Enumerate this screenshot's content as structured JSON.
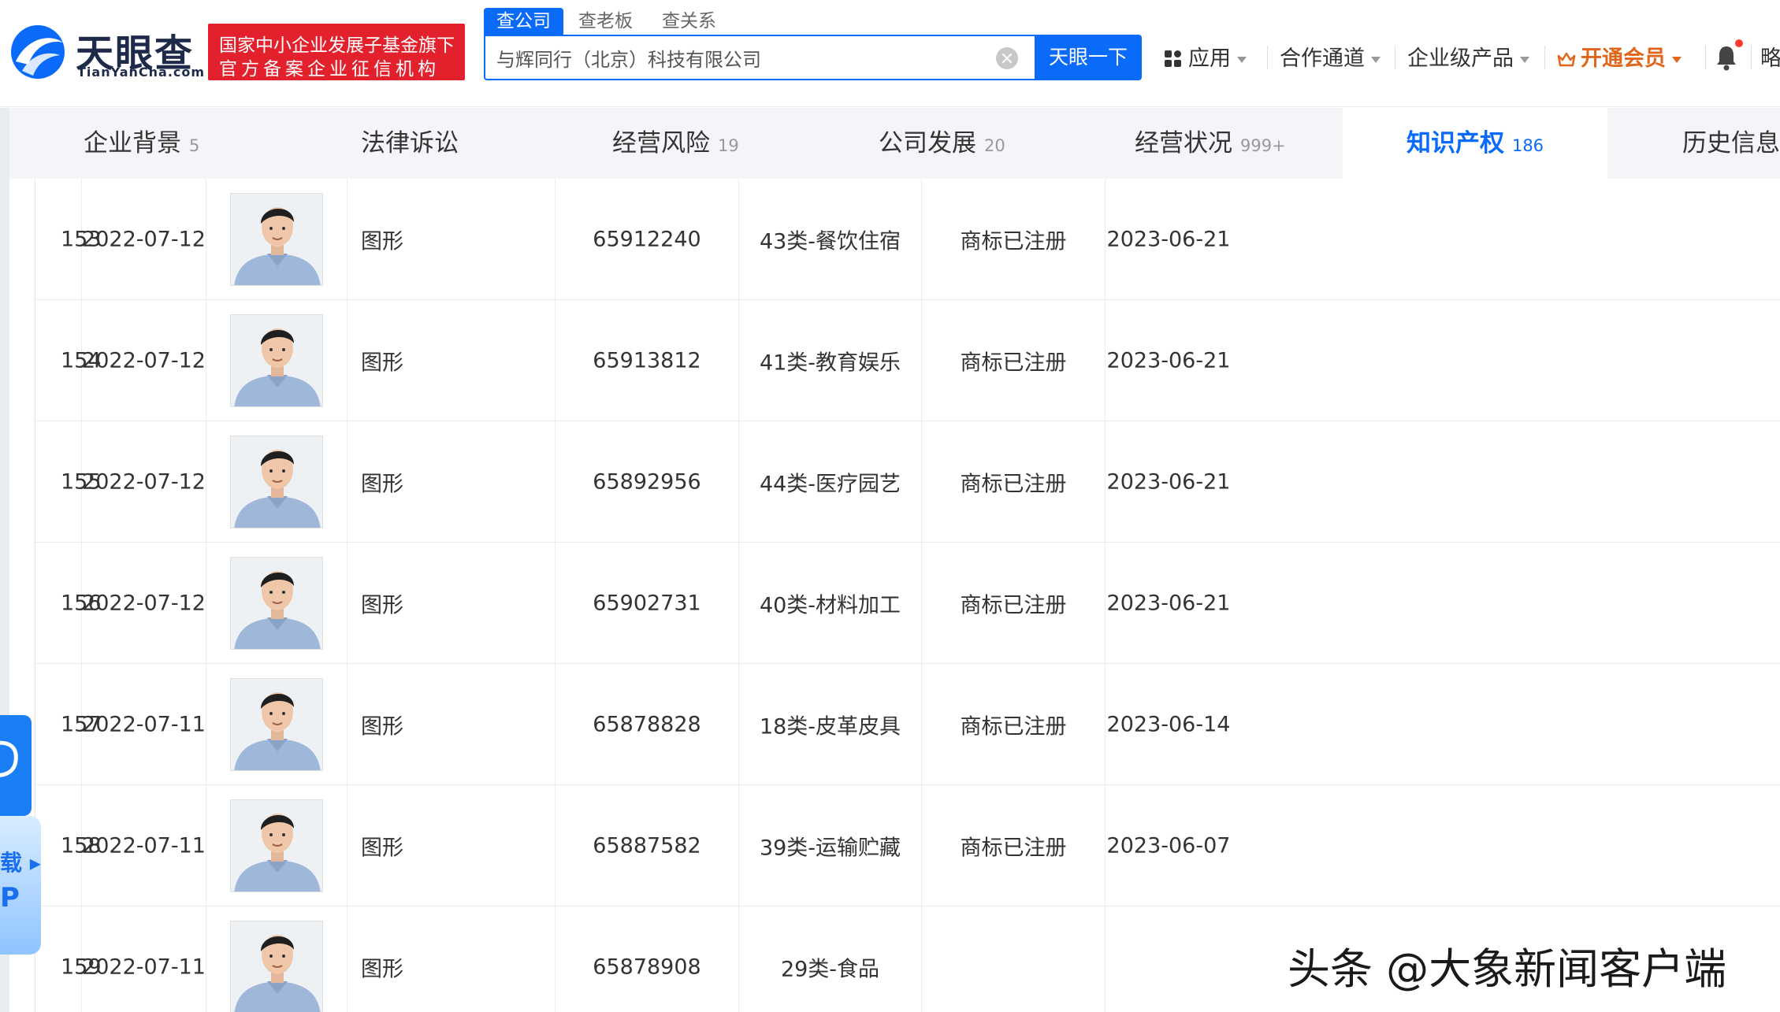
{
  "brand": {
    "logo_cn": "天眼查",
    "logo_en": "TianYanCha.com",
    "gov_line1": "国家中小企业发展子基金旗下",
    "gov_line2": "官方备案企业征信机构",
    "brand_color": "#0a6bfa",
    "badge_color": "#e3212c"
  },
  "search": {
    "tabs": [
      "查公司",
      "查老板",
      "查关系"
    ],
    "value": "与辉同行（北京）科技有限公司",
    "button": "天眼一下"
  },
  "nav": {
    "apps": "应用",
    "partner": "合作通道",
    "enterprise": "企业级产品",
    "vip": "开通会员",
    "cut": "略"
  },
  "categories": [
    {
      "label": "企业背景",
      "count": "5"
    },
    {
      "label": "法律诉讼",
      "count": ""
    },
    {
      "label": "经营风险",
      "count": "19"
    },
    {
      "label": "公司发展",
      "count": "20"
    },
    {
      "label": "经营状况",
      "count": "999+"
    },
    {
      "label": "知识产权",
      "count": "186"
    },
    {
      "label": "历史信息",
      "count": ""
    }
  ],
  "trademarks": [
    {
      "idx": "153",
      "apply_date": "2022-07-12",
      "name": "图形",
      "reg_no": "65912240",
      "class": "43类-餐饮住宿",
      "status": "商标已注册",
      "date": "2023-06-21"
    },
    {
      "idx": "154",
      "apply_date": "2022-07-12",
      "name": "图形",
      "reg_no": "65913812",
      "class": "41类-教育娱乐",
      "status": "商标已注册",
      "date": "2023-06-21"
    },
    {
      "idx": "155",
      "apply_date": "2022-07-12",
      "name": "图形",
      "reg_no": "65892956",
      "class": "44类-医疗园艺",
      "status": "商标已注册",
      "date": "2023-06-21"
    },
    {
      "idx": "156",
      "apply_date": "2022-07-12",
      "name": "图形",
      "reg_no": "65902731",
      "class": "40类-材料加工",
      "status": "商标已注册",
      "date": "2023-06-21"
    },
    {
      "idx": "157",
      "apply_date": "2022-07-11",
      "name": "图形",
      "reg_no": "65878828",
      "class": "18类-皮革皮具",
      "status": "商标已注册",
      "date": "2023-06-14"
    },
    {
      "idx": "158",
      "apply_date": "2022-07-11",
      "name": "图形",
      "reg_no": "65887582",
      "class": "39类-运输贮藏",
      "status": "商标已注册",
      "date": "2023-06-07"
    },
    {
      "idx": "159",
      "apply_date": "2022-07-11",
      "name": "图形",
      "reg_no": "65878908",
      "class": "29类-食品",
      "status": "",
      "date": ""
    }
  ],
  "side_widget": {
    "line1": "载 ▸",
    "line2": "P"
  },
  "watermark": "头条 @大象新闻客户端"
}
